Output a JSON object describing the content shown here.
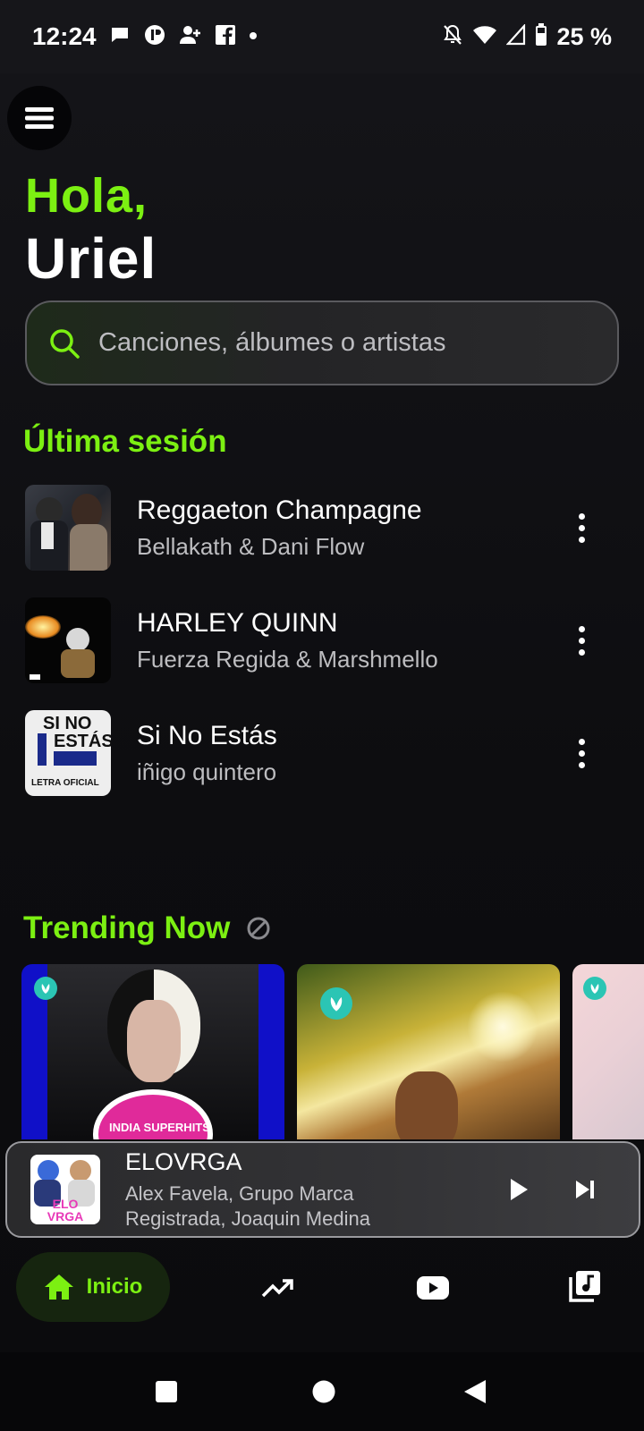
{
  "status_bar": {
    "time": "12:24",
    "battery": "25 %"
  },
  "greeting": {
    "line1": "Hola,",
    "line2": "Uriel"
  },
  "search": {
    "placeholder": "Canciones, álbumes o artistas"
  },
  "last_session": {
    "title": "Última sesión",
    "songs": [
      {
        "title": "Reggaeton Champagne",
        "artist": "Bellakath & Dani Flow"
      },
      {
        "title": "HARLEY QUINN",
        "artist": "Fuerza Regida & Marshmello"
      },
      {
        "title": "Si No Estás",
        "artist": "iñigo quintero",
        "cover_text_1": "SI NO",
        "cover_text_2": "ESTÁS",
        "cover_text_3": "LETRA OFICIAL"
      }
    ]
  },
  "trending": {
    "title": "Trending Now",
    "card1_text": "INDIA SUPERHITS"
  },
  "player": {
    "title": "ELOVRGA",
    "artist": "Alex Favela, Grupo Marca Registrada, Joaquin Medina",
    "art_text": "ELO VRGA"
  },
  "nav": {
    "home_label": "Inicio"
  },
  "colors": {
    "accent": "#7cf012",
    "background": "#0c0c0e",
    "saavn_teal": "#2bc5b4"
  }
}
